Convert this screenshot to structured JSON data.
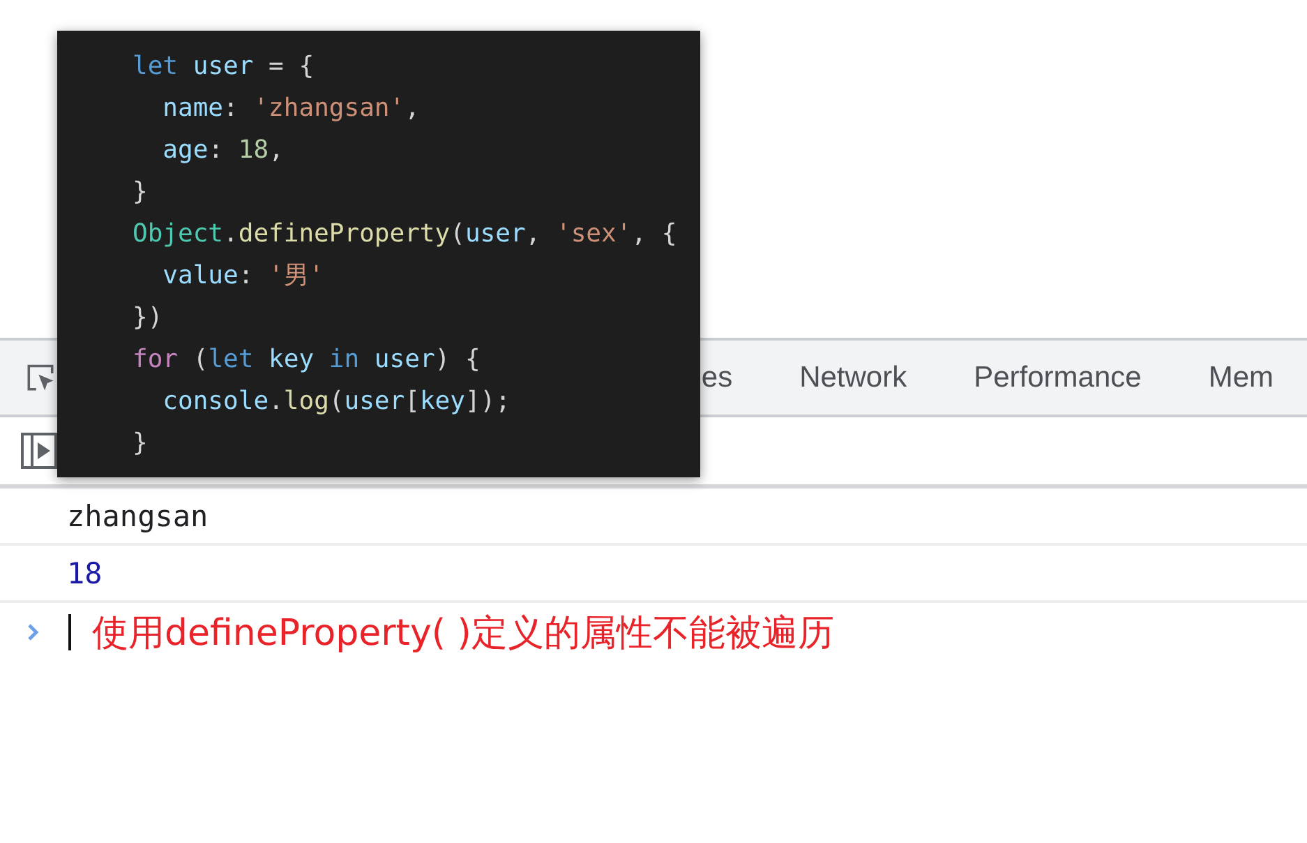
{
  "code_popup": {
    "lines": [
      [
        {
          "kind": "keyword",
          "text": "let"
        },
        {
          "kind": "variable",
          "text": " user"
        },
        {
          "kind": "plain",
          "text": " = {"
        }
      ],
      [
        {
          "kind": "variable",
          "text": "  name"
        },
        {
          "kind": "plain",
          "text": ": "
        },
        {
          "kind": "string",
          "text": "'zhangsan'"
        },
        {
          "kind": "plain",
          "text": ","
        }
      ],
      [
        {
          "kind": "variable",
          "text": "  age"
        },
        {
          "kind": "plain",
          "text": ": "
        },
        {
          "kind": "number",
          "text": "18"
        },
        {
          "kind": "plain",
          "text": ","
        }
      ],
      [
        {
          "kind": "plain",
          "text": "}"
        }
      ],
      [
        {
          "kind": "type",
          "text": "Object"
        },
        {
          "kind": "plain",
          "text": "."
        },
        {
          "kind": "function",
          "text": "defineProperty"
        },
        {
          "kind": "plain",
          "text": "("
        },
        {
          "kind": "variable",
          "text": "user"
        },
        {
          "kind": "plain",
          "text": ", "
        },
        {
          "kind": "string",
          "text": "'sex'"
        },
        {
          "kind": "plain",
          "text": ", {"
        }
      ],
      [
        {
          "kind": "variable",
          "text": "  value"
        },
        {
          "kind": "plain",
          "text": ": "
        },
        {
          "kind": "string",
          "text": "'男'"
        }
      ],
      [
        {
          "kind": "plain",
          "text": "})"
        }
      ],
      [
        {
          "kind": "control",
          "text": "for"
        },
        {
          "kind": "plain",
          "text": " ("
        },
        {
          "kind": "keyword",
          "text": "let"
        },
        {
          "kind": "variable",
          "text": " key"
        },
        {
          "kind": "keyword",
          "text": " in"
        },
        {
          "kind": "variable",
          "text": " user"
        },
        {
          "kind": "plain",
          "text": ") {"
        }
      ],
      [
        {
          "kind": "variable",
          "text": "  console"
        },
        {
          "kind": "plain",
          "text": "."
        },
        {
          "kind": "function",
          "text": "log"
        },
        {
          "kind": "plain",
          "text": "("
        },
        {
          "kind": "variable",
          "text": "user"
        },
        {
          "kind": "plain",
          "text": "["
        },
        {
          "kind": "variable",
          "text": "key"
        },
        {
          "kind": "plain",
          "text": "]);"
        }
      ],
      [
        {
          "kind": "plain",
          "text": "}"
        }
      ]
    ]
  },
  "devtools": {
    "tabs": [
      {
        "label": "es",
        "selected": false
      },
      {
        "label": "Network",
        "selected": false
      },
      {
        "label": "Performance",
        "selected": false
      },
      {
        "label": "Mem",
        "selected": false
      }
    ],
    "console": {
      "messages": [
        {
          "kind": "string",
          "text": "zhangsan"
        },
        {
          "kind": "number",
          "text": "18"
        }
      ],
      "input": "使用defineProperty( )定义的属性不能被遍历"
    }
  }
}
